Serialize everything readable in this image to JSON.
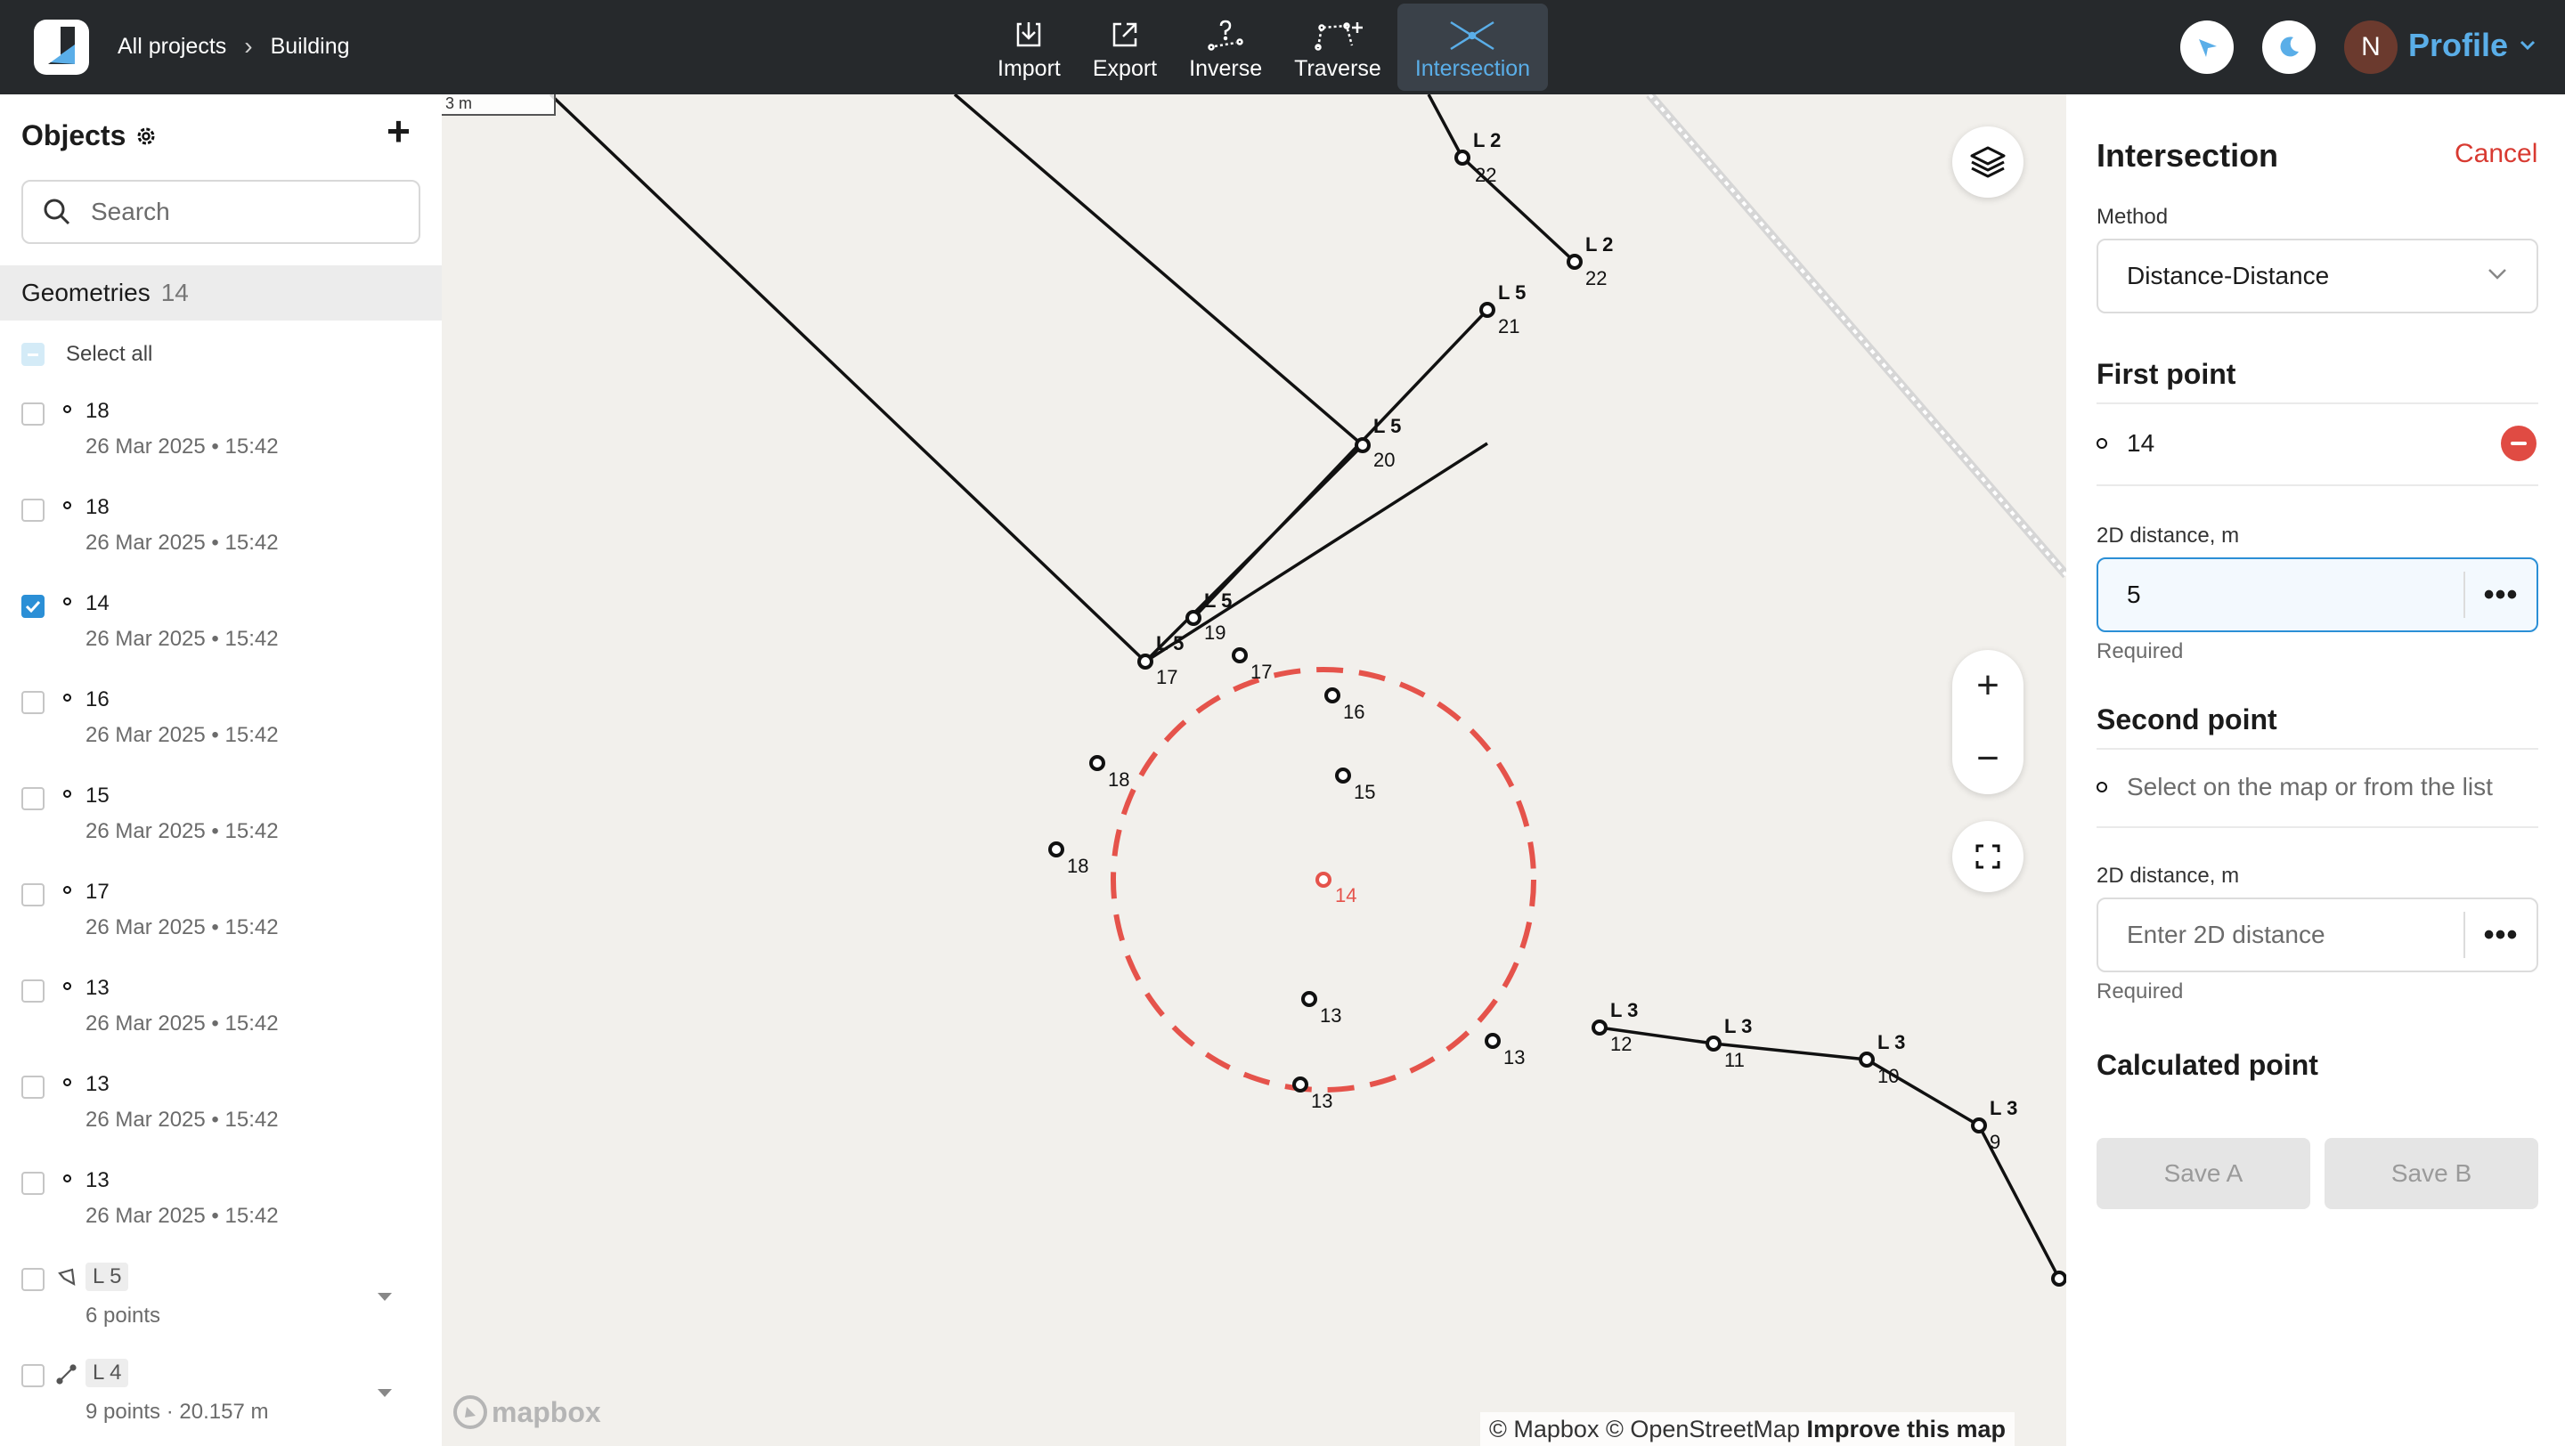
{
  "header": {
    "breadcrumb": [
      "All projects",
      "Building"
    ],
    "tools": [
      {
        "label": "Import",
        "icon": "import-icon"
      },
      {
        "label": "Export",
        "icon": "export-icon"
      },
      {
        "label": "Inverse",
        "icon": "inverse-icon"
      },
      {
        "label": "Traverse",
        "icon": "traverse-icon"
      },
      {
        "label": "Intersection",
        "icon": "intersection-icon",
        "active": true
      }
    ],
    "avatar_initial": "N",
    "profile_label": "Profile",
    "accent_color": "#5aaee8"
  },
  "sidebar": {
    "title": "Objects",
    "search_placeholder": "Search",
    "geometries_label": "Geometries",
    "geometries_count": "14",
    "select_all_label": "Select all",
    "items": [
      {
        "name": "18",
        "date": "26 Mar 2025 • 15:42",
        "checked": false
      },
      {
        "name": "18",
        "date": "26 Mar 2025 • 15:42",
        "checked": false
      },
      {
        "name": "14",
        "date": "26 Mar 2025 • 15:42",
        "checked": true
      },
      {
        "name": "16",
        "date": "26 Mar 2025 • 15:42",
        "checked": false
      },
      {
        "name": "15",
        "date": "26 Mar 2025 • 15:42",
        "checked": false
      },
      {
        "name": "17",
        "date": "26 Mar 2025 • 15:42",
        "checked": false
      },
      {
        "name": "13",
        "date": "26 Mar 2025 • 15:42",
        "checked": false
      },
      {
        "name": "13",
        "date": "26 Mar 2025 • 15:42",
        "checked": false
      },
      {
        "name": "13",
        "date": "26 Mar 2025 • 15:42",
        "checked": false
      }
    ],
    "groups": [
      {
        "tag": "L 5",
        "sub": "6 points",
        "icon": "polygon-icon"
      },
      {
        "tag": "L 4",
        "sub": "9 points · 20.157 m",
        "icon": "polyline-icon"
      }
    ]
  },
  "map": {
    "scale_label": "3 m",
    "line_labels": [
      "L 2",
      "L 2",
      "L 5",
      "L 5",
      "L 5",
      "L 5",
      "L 3",
      "L 3",
      "L 3",
      "L 3"
    ],
    "point_labels": [
      "22",
      "22",
      "21",
      "20",
      "19",
      "17",
      "17",
      "16",
      "15",
      "18",
      "18",
      "14",
      "13",
      "13",
      "13",
      "12",
      "11",
      "10",
      "9"
    ],
    "circle_color": "#e5534b",
    "mapbox_label": "mapbox",
    "attribution": "© Mapbox © OpenStreetMap",
    "improve_label": "Improve this map"
  },
  "panel": {
    "title": "Intersection",
    "cancel_label": "Cancel",
    "method_label": "Method",
    "method_value": "Distance-Distance",
    "first_point_title": "First point",
    "first_point_value": "14",
    "distance_label": "2D distance, m",
    "first_distance_value": "5",
    "required_label": "Required",
    "second_point_title": "Second point",
    "second_point_placeholder": "Select on the map or from the list",
    "second_distance_placeholder": "Enter 2D distance",
    "calculated_title": "Calculated point",
    "save_a_label": "Save A",
    "save_b_label": "Save B",
    "remove_color": "#e04b43"
  }
}
